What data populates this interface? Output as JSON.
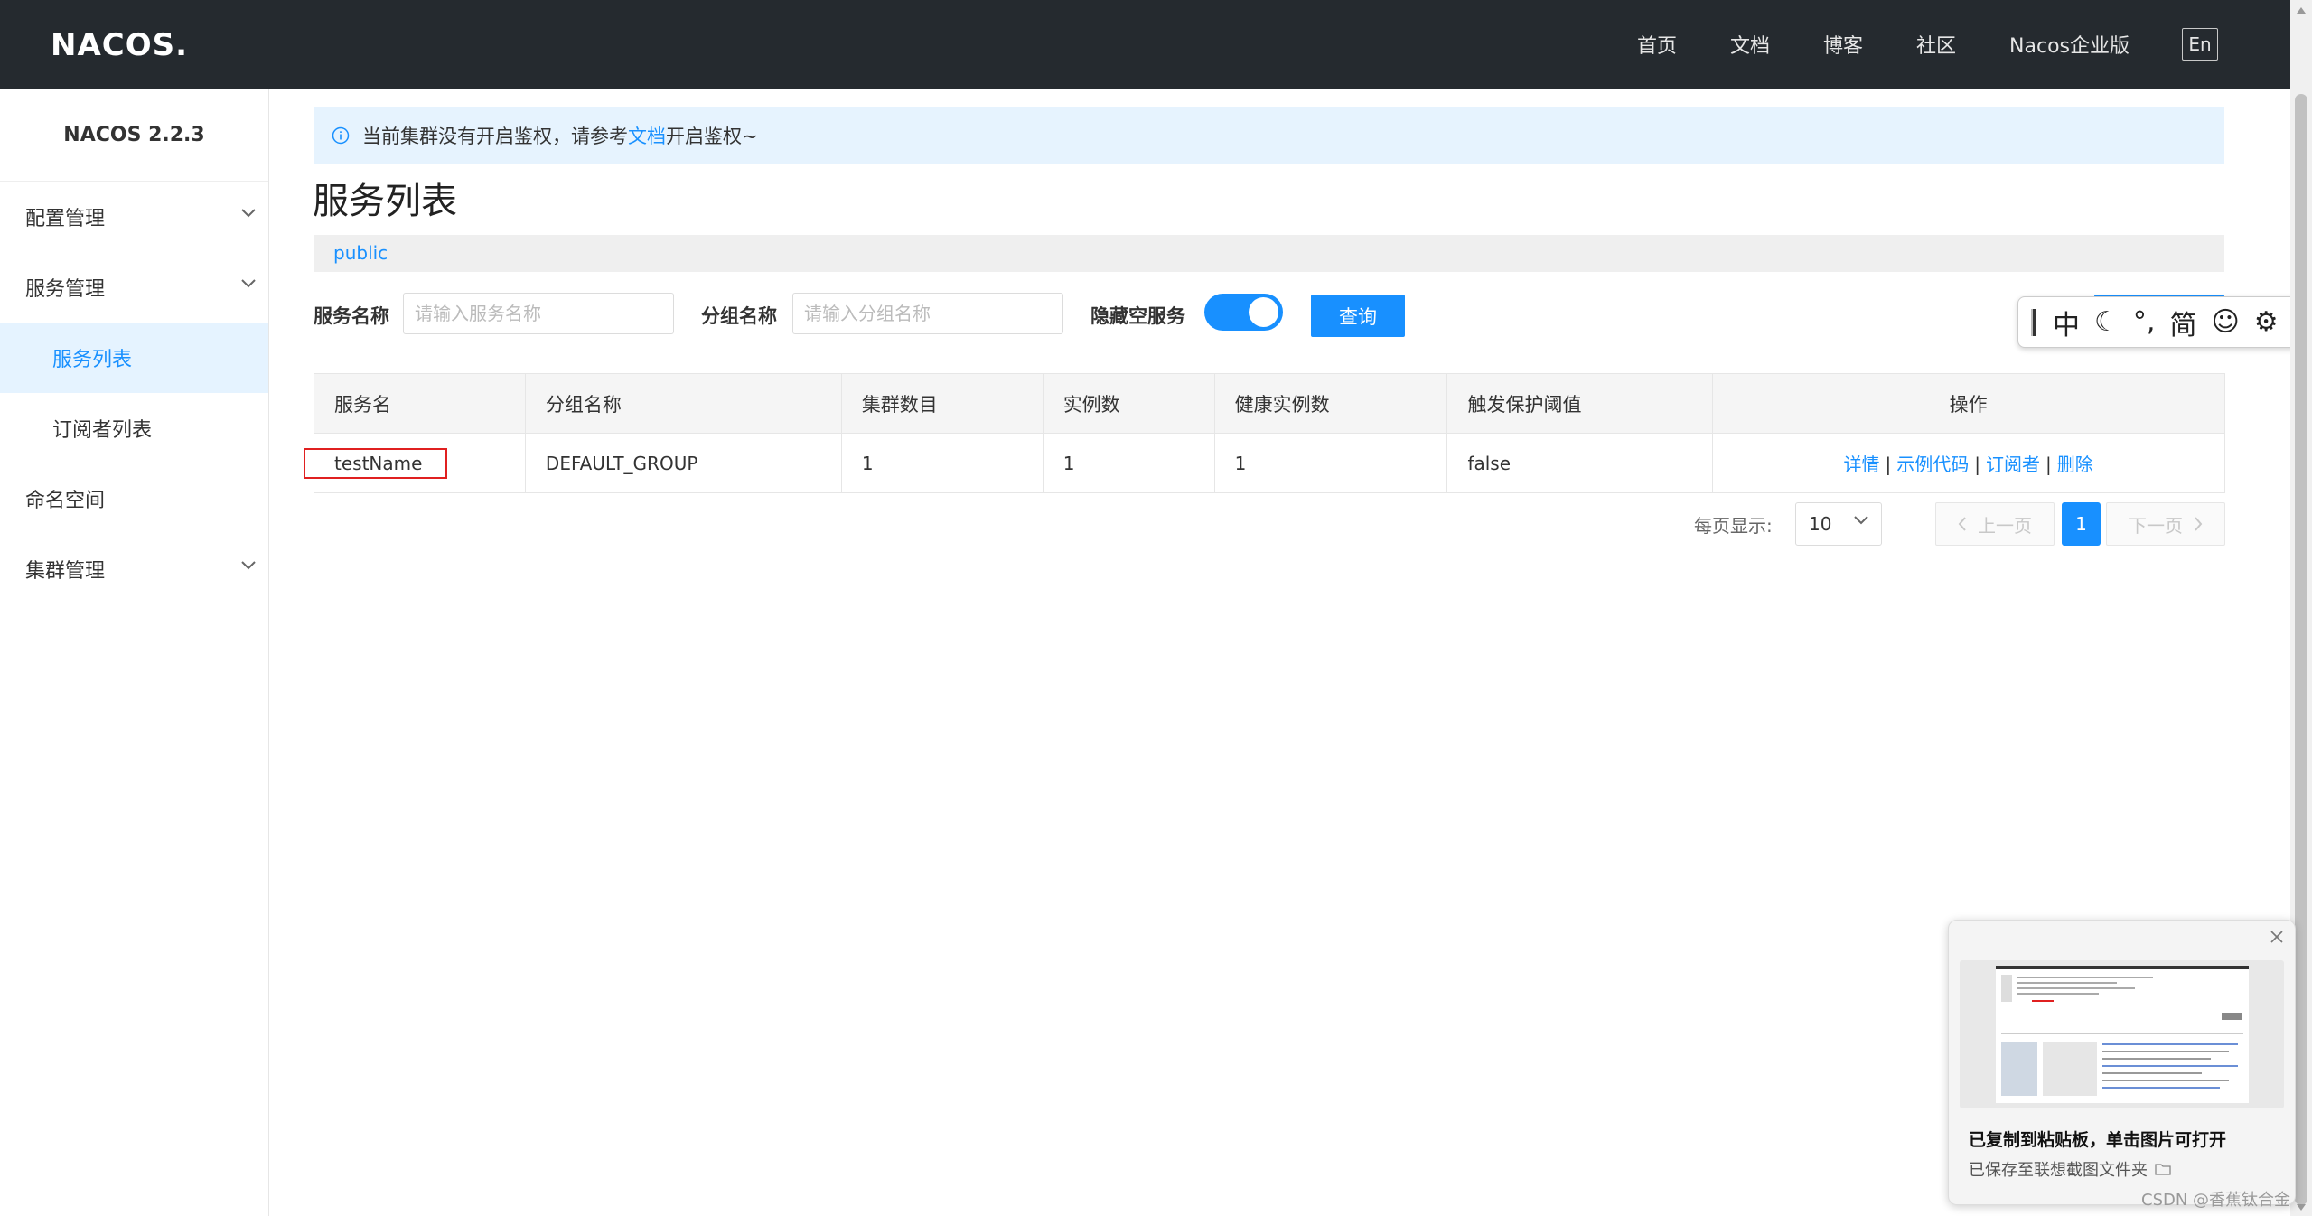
{
  "header": {
    "logo_text": "NACOS.",
    "nav": [
      "首页",
      "文档",
      "博客",
      "社区",
      "Nacos企业版"
    ],
    "lang": "En"
  },
  "sidebar": {
    "version": "NACOS 2.2.3",
    "items": [
      {
        "label": "配置管理",
        "expandable": true
      },
      {
        "label": "服务管理",
        "expandable": true
      },
      {
        "label": "服务列表",
        "sub": true,
        "active": true
      },
      {
        "label": "订阅者列表",
        "sub": true
      },
      {
        "label": "命名空间"
      },
      {
        "label": "集群管理",
        "expandable": true
      }
    ]
  },
  "notice": {
    "prefix": "当前集群没有开启鉴权，请参考",
    "link": "文档",
    "suffix": "开启鉴权~"
  },
  "page_title": "服务列表",
  "namespace": "public",
  "filters": {
    "service_label": "服务名称",
    "service_placeholder": "请输入服务名称",
    "group_label": "分组名称",
    "group_placeholder": "请输入分组名称",
    "hide_empty_label": "隐藏空服务",
    "hide_empty_on": true,
    "query_button": "查询"
  },
  "ime": {
    "items": [
      "中",
      "☾",
      "°,",
      "简",
      "☺",
      "⚙"
    ]
  },
  "table": {
    "headers": [
      "服务名",
      "分组名称",
      "集群数目",
      "实例数",
      "健康实例数",
      "触发保护阈值",
      "操作"
    ],
    "rows": [
      {
        "service": "testName",
        "group": "DEFAULT_GROUP",
        "clusters": "1",
        "instances": "1",
        "healthy": "1",
        "threshold": "false"
      }
    ],
    "actions": [
      "详情",
      "示例代码",
      "订阅者",
      "删除"
    ]
  },
  "pagination": {
    "page_size_label": "每页显示:",
    "page_size": "10",
    "prev": "上一页",
    "current": "1",
    "next": "下一页"
  },
  "toast": {
    "title": "已复制到粘贴板，单击图片可打开",
    "subtitle": "已保存至联想截图文件夹"
  },
  "watermark": "CSDN @香蕉钛合金",
  "colors": {
    "accent": "#1890ff",
    "header_bg": "#252a2f",
    "notice_bg": "#e6f3fe",
    "highlight": "#e02020"
  }
}
